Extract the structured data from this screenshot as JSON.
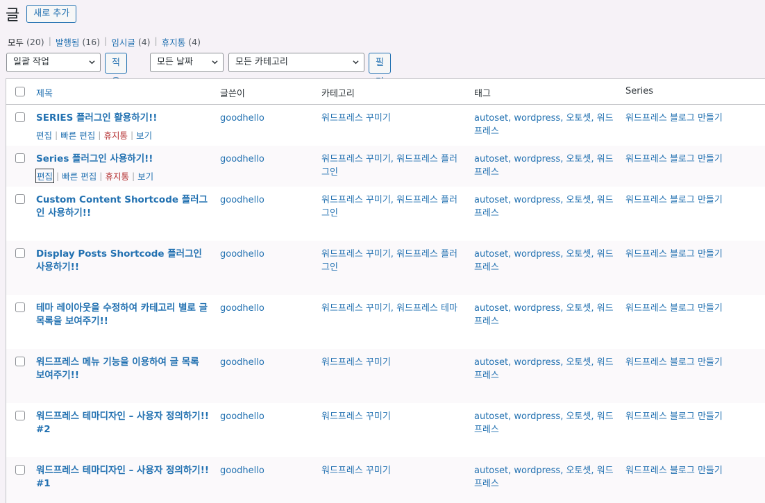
{
  "header": {
    "title": "글",
    "add_new": "새로 추가"
  },
  "filters": {
    "views": [
      {
        "label": "모두",
        "count": "(20)",
        "current": true
      },
      {
        "label": "발행됨",
        "count": "(16)"
      },
      {
        "label": "임시글",
        "count": "(4)"
      },
      {
        "label": "휴지통",
        "count": "(4)"
      }
    ],
    "bulk_action": "일괄 작업",
    "apply": "적용",
    "date_filter": "모든 날짜",
    "category_filter": "모든 카테고리",
    "filter_button": "필터"
  },
  "table": {
    "columns": [
      "제목",
      "글쓴이",
      "카테고리",
      "태그",
      "Series"
    ],
    "row_actions": [
      "편집",
      "빠른 편집",
      "휴지통",
      "보기"
    ],
    "rows": [
      {
        "title": "SERIES 플러그인 활용하기!!",
        "author": "goodhello",
        "categories": "워드프레스 꾸미기",
        "tags": "autoset, wordpress, 오토셋, 워드프레스",
        "series": "워드프레스 블로그 만들기",
        "actions": true
      },
      {
        "title": "Series 플러그인 사용하기!!",
        "author": "goodhello",
        "categories": "워드프레스 꾸미기, 워드프레스 플러그인",
        "tags": "autoset, wordpress, 오토셋, 워드프레스",
        "series": "워드프레스 블로그 만들기",
        "actions": true,
        "focused": true
      },
      {
        "title": "Custom Content Shortcode 플러그인 사용하기!!",
        "author": "goodhello",
        "categories": "워드프레스 꾸미기, 워드프레스 플러그인",
        "tags": "autoset, wordpress, 오토셋, 워드프레스",
        "series": "워드프레스 블로그 만들기"
      },
      {
        "title": "Display Posts Shortcode 플러그인 사용하기!!",
        "author": "goodhello",
        "categories": "워드프레스 꾸미기, 워드프레스 플러그인",
        "tags": "autoset, wordpress, 오토셋, 워드프레스",
        "series": "워드프레스 블로그 만들기"
      },
      {
        "title": "테마 레이아웃을 수정하여 카테고리 별로 글 목록을 보여주기!!",
        "author": "goodhello",
        "categories": "워드프레스 꾸미기, 워드프레스 테마",
        "tags": "autoset, wordpress, 오토셋, 워드프레스",
        "series": "워드프레스 블로그 만들기"
      },
      {
        "title": "워드프레스 메뉴 기능을 이용하여 글 목록 보여주기!!",
        "author": "goodhello",
        "categories": "워드프레스 꾸미기",
        "tags": "autoset, wordpress, 오토셋, 워드프레스",
        "series": "워드프레스 블로그 만들기"
      },
      {
        "title": "워드프레스 테마디자인 – 사용자 정의하기!! #2",
        "author": "goodhello",
        "categories": "워드프레스 꾸미기",
        "tags": "autoset, wordpress, 오토셋, 워드프레스",
        "series": "워드프레스 블로그 만들기"
      },
      {
        "title": "워드프레스 테마디자인 – 사용자 정의하기!! #1",
        "author": "goodhello",
        "categories": "워드프레스 꾸미기",
        "tags": "autoset, wordpress, 오토셋, 워드프레스",
        "series": "워드프레스 블로그 만들기"
      }
    ]
  },
  "colors": {
    "link": "#2271b1",
    "trash": "#b32d2e",
    "background": "#f6f2f7"
  }
}
